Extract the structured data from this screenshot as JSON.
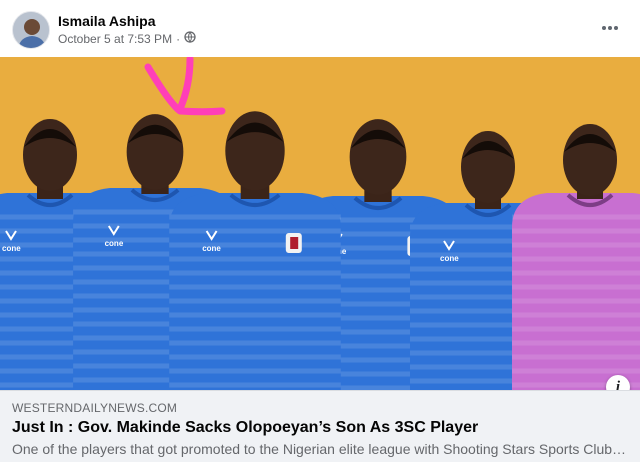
{
  "post": {
    "author": "Ismaila Ashipa",
    "timestamp": "October 5 at 7:53 PM",
    "separator": "·",
    "audience_icon": "globe-icon",
    "more_icon": "more-options-icon"
  },
  "photo": {
    "subject": "team-photo",
    "background_color": "#e9ad3f",
    "jersey_color": "#2f73d8",
    "goalkeeper_color": "#c86fd1",
    "annotation_color": "#ff3fb8",
    "sponsor_text": "cone"
  },
  "link": {
    "domain": "WESTERNDAILYNEWS.COM",
    "title": "Just In : Gov. Makinde Sacks Olopoeyan’s Son As 3SC Player",
    "description": "One of the players that got promoted to the Nigerian elite league with Shooting Stars Sports Club of ...",
    "info_label": "i"
  }
}
